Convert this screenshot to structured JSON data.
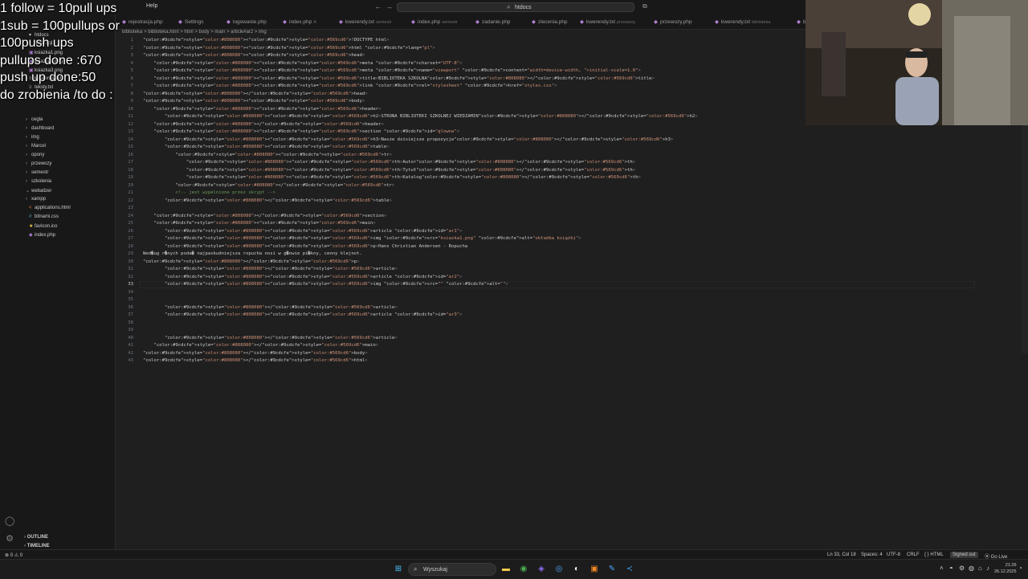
{
  "menu": {
    "help": "Help"
  },
  "search": {
    "text": "htdocs"
  },
  "overlay_lines": [
    "1 follow = 10pull ups",
    "1sub = 100pullups or",
    "100push ups",
    "pullups done :670",
    "push up done:50",
    "do zrobienia /to do :"
  ],
  "sidebar": {
    "files_top": [
      {
        "name": "htdocs",
        "type": "folder"
      },
      {
        "name": "baza.sql",
        "type": "sql"
      },
      {
        "name": "ksiazka1.png",
        "type": "image"
      },
      {
        "name": "ksiazka2.png",
        "type": "image"
      },
      {
        "name": "ksiazka3.png",
        "type": "image"
      },
      {
        "name": "kwerendy.txt",
        "type": "text"
      },
      {
        "name": "teksty.txt",
        "type": "text"
      }
    ],
    "folders": [
      {
        "name": "cegla",
        "expanded": false
      },
      {
        "name": "dashboard",
        "expanded": false
      },
      {
        "name": "img",
        "expanded": false
      },
      {
        "name": "Marcel",
        "expanded": false
      },
      {
        "name": "opony",
        "expanded": false
      },
      {
        "name": "przewozy",
        "expanded": false
      },
      {
        "name": "semestr",
        "expanded": false
      },
      {
        "name": "szkolenia",
        "expanded": false
      },
      {
        "name": "webalizer",
        "expanded": true
      },
      {
        "name": "xampp",
        "expanded": false
      }
    ],
    "files_bottom": [
      {
        "name": "applications.html",
        "type": "html"
      },
      {
        "name": "bitnami.css",
        "type": "css"
      },
      {
        "name": "favicon.ico",
        "type": "ico"
      },
      {
        "name": "index.php",
        "type": "php"
      }
    ],
    "outline": "OUTLINE",
    "timeline": "TIMELINE"
  },
  "tabs": [
    {
      "label": "rejestracja.php",
      "desc": ""
    },
    {
      "label": "Settings",
      "desc": ""
    },
    {
      "label": "logowanie.php",
      "desc": ""
    },
    {
      "label": "index.php",
      "desc": "A"
    },
    {
      "label": "kwerendy.txt",
      "desc": "semestr"
    },
    {
      "label": "index.php",
      "desc": "semestr"
    },
    {
      "label": "zadanie.php",
      "desc": ""
    },
    {
      "label": "zlecenia.php",
      "desc": ""
    },
    {
      "label": "kwerendy.txt",
      "desc": "przewozy"
    },
    {
      "label": "przewozy.php",
      "desc": ""
    },
    {
      "label": "kwerendy.txt",
      "desc": "biblioteka"
    },
    {
      "label": "bibl",
      "desc": ""
    }
  ],
  "breadcrumb": "biblioteka > biblioteka.html > html > body > main > article#ar2 > img",
  "code_lines": [
    "<!DOCTYPE html>",
    "<html lang=\"pl\">",
    "<head>",
    "    <meta charset=\"UTF-8\">",
    "    <meta name=\"viewport\" content=\"width=device-width, initial-scale=1.0\">",
    "    <title>BIBLIOTEKA SZKOLNA</title>",
    "    <link rel=\"stylesheet\" href=\"styles.css\">",
    "</head>",
    "<body>",
    "    <header>",
    "        <h2>STRONA BIBLIOTEKI SZKOLNEJ WIEDZAMIN</h2>",
    "    </header>",
    "    <section id=\"glowna\">",
    "        <h3>Nasze dzisiejsze propozycje</h3>",
    "        <table>",
    "            <tr>",
    "                <th>Autor</th>",
    "                <th>Tytuł</th>",
    "                <th>Katalog</th>",
    "            </tr>",
    "            <!-- jest wypelnione przez skrypt -->",
    "        </table>",
    "",
    "    </section>",
    "    <main>",
    "        <article id=\"ar1\">",
    "        <img src=\"ksiazka1.png\" alt=\"okładka książki\">",
    "        <p>Hans Christian Andersen - Ropucha",
    "Wed�ug r�nych poda� najpaskudniejsza ropucha nosi w g�owie pi�kny, cenny klejnot.",
    "</p>",
    "        </article>",
    "        <article id=\"ar2\">",
    "        <img src=\"\" alt=\"\">",
    "",
    "",
    "        </article>",
    "        <article id=\"ar3\">",
    "",
    "",
    "        </article>",
    "    </main>",
    "</body>",
    "</html>"
  ],
  "active_line": 33,
  "statusbar": {
    "left": "⊗ 0 ⚠ 0",
    "position": "Ln 33, Col 18",
    "spaces": "Spaces: 4",
    "encoding": "UTF-8",
    "eol": "CRLF",
    "language": "{ } HTML",
    "signed_out": "Signed out",
    "golive": "Go Live"
  },
  "taskbar": {
    "search_label": "Wyszukaj",
    "time": "21:26",
    "date": "26.12.2025"
  },
  "colors": {
    "background": "#1f1f1f",
    "tag": "#569cd6",
    "attr": "#9cdcfe",
    "string": "#ce9178",
    "comment": "#6a9955",
    "text": "#cccccc"
  }
}
